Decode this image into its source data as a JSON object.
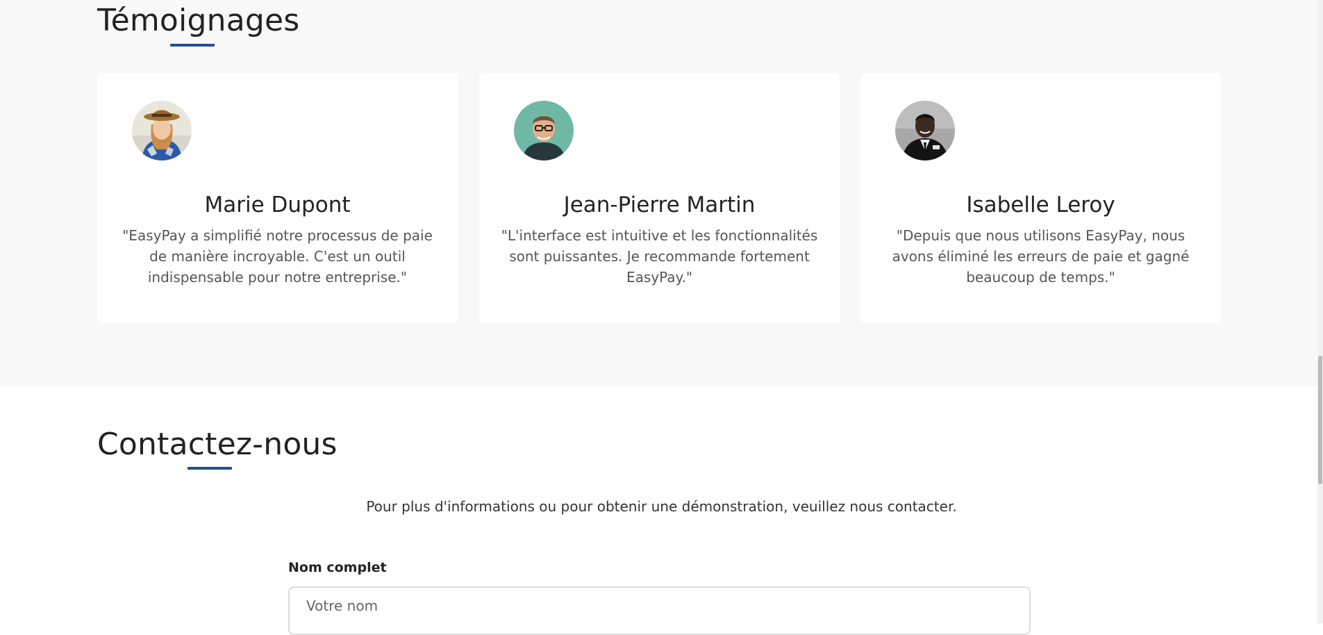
{
  "testimonials": {
    "title": "Témoignages",
    "cards": [
      {
        "name": "Marie Dupont",
        "quote": "\"EasyPay a simplifié notre processus de paie de manière incroyable. C'est un outil indispensable pour notre entreprise.\"",
        "avatar": "woman-with-hat-avatar"
      },
      {
        "name": "Jean-Pierre Martin",
        "quote": "\"L'interface est intuitive et les fonctionnalités sont puissantes. Je recommande fortement EasyPay.\"",
        "avatar": "man-with-glasses-avatar"
      },
      {
        "name": "Isabelle Leroy",
        "quote": "\"Depuis que nous utilisons EasyPay, nous avons éliminé les erreurs de paie et gagné beaucoup de temps.\"",
        "avatar": "man-in-suit-avatar"
      }
    ]
  },
  "contact": {
    "title": "Contactez-nous",
    "intro": "Pour plus d'informations ou pour obtenir une démonstration, veuillez nous contacter.",
    "name_field": {
      "label": "Nom complet",
      "placeholder": "Votre nom",
      "value": ""
    }
  },
  "colors": {
    "accent": "#1f4f93",
    "section_bg": "#f8f8f8",
    "card_bg": "#ffffff"
  }
}
